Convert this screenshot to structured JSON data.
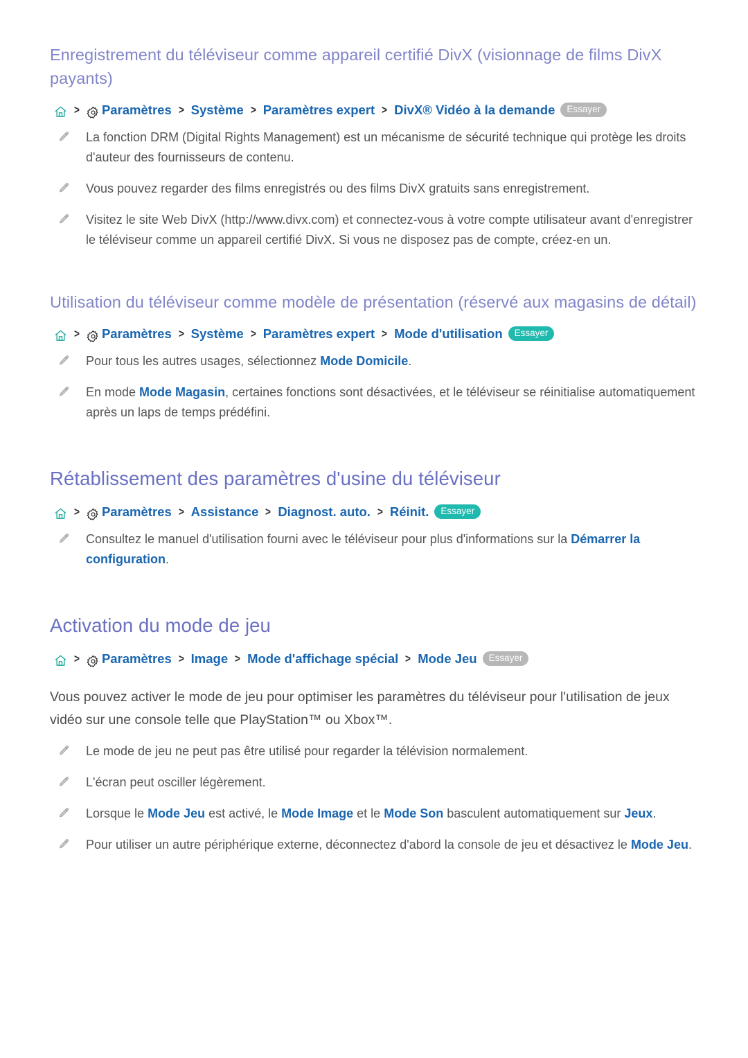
{
  "icons": {
    "home": "home-icon",
    "gear": "gear-icon",
    "separator": "chevron-right-icon",
    "note_bullet": "pencil-note-icon"
  },
  "colors": {
    "sub_heading": "#8185c8",
    "main_heading": "#6a70c2",
    "breadcrumb_link": "#1a66b0",
    "badge_active": "#1fb9ad",
    "badge_disabled": "#b7b7b7",
    "body_text": "#545454",
    "highlight": "#1a66b0"
  },
  "sections": [
    {
      "id": "divx",
      "heading": "Enregistrement du téléviseur comme appareil certifié DivX (visionnage de films DivX payants)",
      "heading_level": "sub",
      "breadcrumb": {
        "crumbs": [
          "Paramètres",
          "Système",
          "Paramètres expert",
          "DivX® Vidéo à la demande"
        ],
        "separator": ">",
        "badge": {
          "label": "Essayer",
          "state": "disabled"
        }
      },
      "notes": [
        {
          "parts": [
            {
              "t": "La fonction DRM (Digital Rights Management) est un mécanisme de sécurité technique qui protège les droits d'auteur des fournisseurs de contenu.",
              "b": false
            }
          ]
        },
        {
          "parts": [
            {
              "t": "Vous pouvez regarder des films enregistrés ou des films DivX gratuits sans enregistrement.",
              "b": false
            }
          ]
        },
        {
          "parts": [
            {
              "t": "Visitez le site Web DivX (http://www.divx.com) et connectez-vous à votre compte utilisateur avant d'enregistrer le téléviseur comme un appareil certifié DivX. Si vous ne disposez pas de compte, créez-en un.",
              "b": false
            }
          ]
        }
      ]
    },
    {
      "id": "demo-mode",
      "heading": "Utilisation du téléviseur comme modèle de présentation (réservé aux magasins de détail)",
      "heading_level": "sub",
      "breadcrumb": {
        "crumbs": [
          "Paramètres",
          "Système",
          "Paramètres expert",
          "Mode d'utilisation"
        ],
        "separator": ">",
        "badge": {
          "label": "Essayer",
          "state": "active"
        }
      },
      "notes": [
        {
          "parts": [
            {
              "t": "Pour tous les autres usages, sélectionnez ",
              "b": false
            },
            {
              "t": "Mode Domicile",
              "b": true
            },
            {
              "t": ".",
              "b": false
            }
          ]
        },
        {
          "parts": [
            {
              "t": "En mode ",
              "b": false
            },
            {
              "t": "Mode Magasin",
              "b": true
            },
            {
              "t": ", certaines fonctions sont désactivées, et le téléviseur se réinitialise automatiquement après un laps de temps prédéfini.",
              "b": false
            }
          ]
        }
      ]
    },
    {
      "id": "factory-reset",
      "heading": "Rétablissement des paramètres d'usine du téléviseur",
      "heading_level": "main",
      "breadcrumb": {
        "crumbs": [
          "Paramètres",
          "Assistance",
          "Diagnost. auto.",
          "Réinit."
        ],
        "separator": ">",
        "badge": {
          "label": "Essayer",
          "state": "active"
        }
      },
      "notes": [
        {
          "parts": [
            {
              "t": "Consultez le manuel d'utilisation fourni avec le téléviseur pour plus d'informations sur la ",
              "b": false
            },
            {
              "t": "Démarrer la configuration",
              "b": true
            },
            {
              "t": ".",
              "b": false
            }
          ]
        }
      ]
    },
    {
      "id": "game-mode",
      "heading": "Activation du mode de jeu",
      "heading_level": "main",
      "breadcrumb": {
        "crumbs": [
          "Paramètres",
          "Image",
          "Mode d'affichage spécial",
          "Mode Jeu"
        ],
        "separator": ">",
        "badge": {
          "label": "Essayer",
          "state": "disabled"
        }
      },
      "paragraph": "Vous pouvez activer le mode de jeu pour optimiser les paramètres du téléviseur pour l'utilisation de jeux vidéo sur une console telle que PlayStation™ ou Xbox™.",
      "notes": [
        {
          "parts": [
            {
              "t": "Le mode de jeu ne peut pas être utilisé pour regarder la télévision normalement.",
              "b": false
            }
          ]
        },
        {
          "parts": [
            {
              "t": "L'écran peut osciller légèrement.",
              "b": false
            }
          ]
        },
        {
          "parts": [
            {
              "t": "Lorsque le ",
              "b": false
            },
            {
              "t": "Mode Jeu",
              "b": true
            },
            {
              "t": " est activé, le ",
              "b": false
            },
            {
              "t": "Mode Image",
              "b": true
            },
            {
              "t": " et le ",
              "b": false
            },
            {
              "t": "Mode Son",
              "b": true
            },
            {
              "t": " basculent automatiquement sur ",
              "b": false
            },
            {
              "t": "Jeux",
              "b": true
            },
            {
              "t": ".",
              "b": false
            }
          ]
        },
        {
          "parts": [
            {
              "t": "Pour utiliser un autre périphérique externe, déconnectez d'abord la console de jeu et désactivez le ",
              "b": false
            },
            {
              "t": "Mode Jeu",
              "b": true
            },
            {
              "t": ".",
              "b": false
            }
          ]
        }
      ]
    }
  ]
}
